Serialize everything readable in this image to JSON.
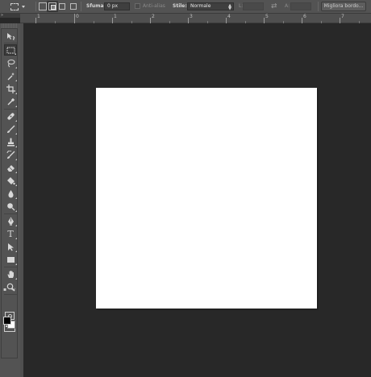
{
  "options_bar": {
    "feather_label": "Sfuma:",
    "feather_value": "0 px",
    "antialias_label": "Anti-alias",
    "style_label": "Stile:",
    "style_value": "Normale",
    "width_label": "L:",
    "height_label": "A:",
    "refine_edge_button": "Migliora bordo..."
  },
  "ruler": {
    "top_numbers": [
      "1",
      "0",
      "1",
      "2",
      "3",
      "4",
      "5",
      "6",
      "7"
    ]
  },
  "toolbox": {
    "collapse_glyph": "»",
    "tools": [
      {
        "name": "move-tool",
        "icon": "move-icon"
      },
      {
        "name": "rectangular-marquee-tool",
        "icon": "marquee-icon",
        "active": true
      },
      {
        "name": "lasso-tool",
        "icon": "lasso-icon"
      },
      {
        "name": "quick-selection-tool",
        "icon": "magic-wand-icon"
      },
      {
        "name": "crop-tool",
        "icon": "crop-icon"
      },
      {
        "name": "eyedropper-tool",
        "icon": "eyedropper-icon"
      },
      {
        "name": "healing-brush-tool",
        "icon": "bandage-icon"
      },
      {
        "name": "brush-tool",
        "icon": "brush-icon"
      },
      {
        "name": "clone-stamp-tool",
        "icon": "stamp-icon"
      },
      {
        "name": "history-brush-tool",
        "icon": "history-brush-icon"
      },
      {
        "name": "eraser-tool",
        "icon": "eraser-icon"
      },
      {
        "name": "paint-bucket-tool",
        "icon": "bucket-icon"
      },
      {
        "name": "blur-tool",
        "icon": "drop-icon"
      },
      {
        "name": "dodge-tool",
        "icon": "dodge-icon"
      },
      {
        "name": "pen-tool",
        "icon": "pen-icon"
      },
      {
        "name": "type-tool",
        "icon": "type-icon",
        "glyph": "T"
      },
      {
        "name": "path-selection-tool",
        "icon": "arrow-icon"
      },
      {
        "name": "rectangle-tool",
        "icon": "rectangle-icon"
      },
      {
        "name": "hand-tool",
        "icon": "hand-icon"
      },
      {
        "name": "zoom-tool",
        "icon": "zoom-icon"
      }
    ],
    "colors": {
      "foreground": "#000000",
      "background": "#ffffff"
    }
  },
  "canvas": {
    "document_color": "#ffffff",
    "pasteboard_color": "#282828"
  }
}
